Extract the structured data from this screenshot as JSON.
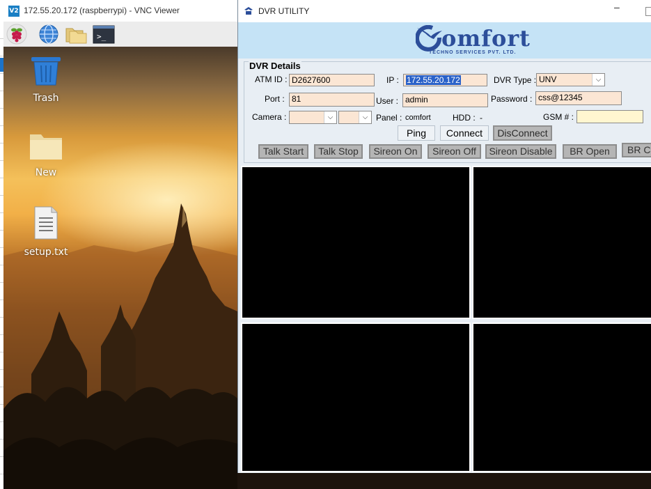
{
  "vnc": {
    "title": "172.55.20.172 (raspberrypi) - VNC Viewer",
    "logo_text": "V2"
  },
  "rpi_panel": {
    "icons": [
      "raspberry-icon",
      "web-browser-icon",
      "file-manager-icon",
      "terminal-icon"
    ]
  },
  "desktop": {
    "icons": [
      {
        "label": "Trash",
        "icon": "trash-icon"
      },
      {
        "label": "New",
        "icon": "folder-icon"
      },
      {
        "label": "setup.txt",
        "icon": "text-file-icon"
      }
    ]
  },
  "dvr": {
    "window_title": "DVR UTILITY",
    "brand_name": "omfort",
    "brand_subtitle": "TECHNO SERVICES PVT. LTD.",
    "section_title": "DVR Details",
    "fields": {
      "atm_id": {
        "label": "ATM ID :",
        "value": "D2627600"
      },
      "ip": {
        "label": "IP :",
        "value": "172.55.20.172"
      },
      "dvr_type": {
        "label": "DVR Type :",
        "value": "UNV"
      },
      "port": {
        "label": "Port :",
        "value": "81"
      },
      "user": {
        "label": "User :",
        "value": "admin"
      },
      "password": {
        "label": "Password :",
        "value": "css@12345"
      },
      "camera": {
        "label": "Camera :",
        "value": "",
        "value2": ""
      },
      "panel": {
        "label": "Panel :",
        "value": "comfort"
      },
      "hdd": {
        "label": "HDD :",
        "value": "-"
      },
      "gsm": {
        "label": "GSM # :",
        "value": ""
      }
    },
    "buttons": {
      "ping": "Ping",
      "connect": "Connect",
      "disconnect": "DisConnect"
    },
    "action_buttons": [
      "Talk Start",
      "Talk Stop",
      "Sireon On",
      "Sireon Off",
      "Sireon Disable",
      "BR Open",
      "BR Cl"
    ],
    "colors": {
      "header_bg": "#c5e3f6",
      "field_bg": "#fbe6d4",
      "brand": "#2c4e9a",
      "selection": "#2a62c9"
    }
  }
}
